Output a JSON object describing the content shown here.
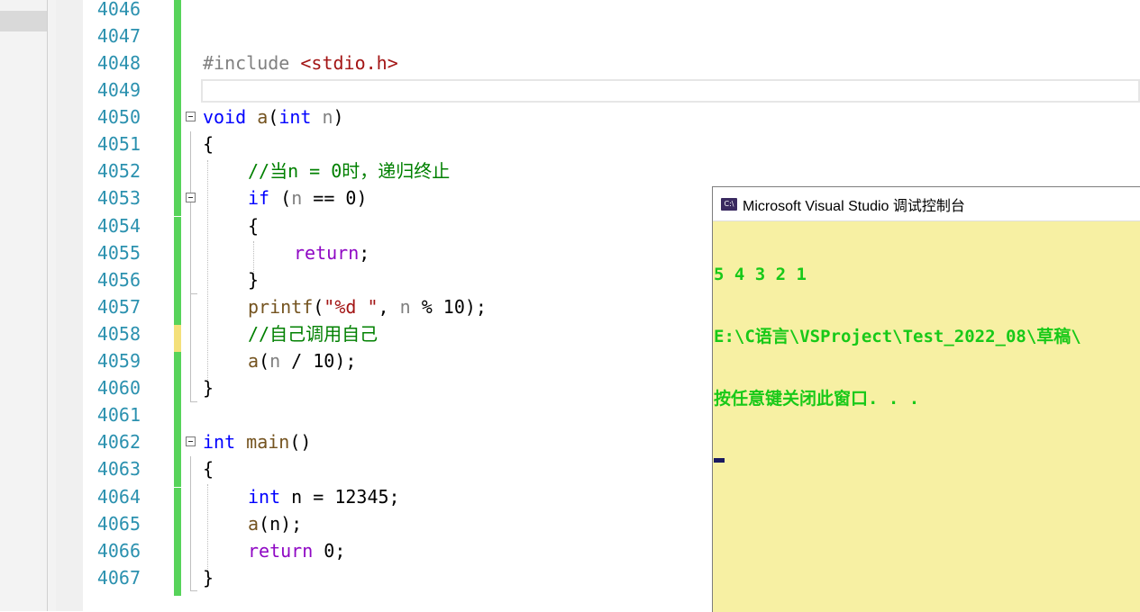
{
  "editor": {
    "lines": [
      {
        "num": "4046"
      },
      {
        "num": "4047"
      },
      {
        "num": "4048",
        "t1": "#include ",
        "t2": "<stdio.h>"
      },
      {
        "num": "4049"
      },
      {
        "num": "4050",
        "t1": "void",
        "t2": " a",
        "t3": "(",
        "t4": "int",
        "t5": " n",
        "t6": ")"
      },
      {
        "num": "4051",
        "t1": "{"
      },
      {
        "num": "4052",
        "t1": "//当n = 0时，递归终止"
      },
      {
        "num": "4053",
        "t1": "if",
        "t2": " (",
        "t3": "n",
        "t4": " == 0)"
      },
      {
        "num": "4054",
        "t1": "{"
      },
      {
        "num": "4055",
        "t1": "return",
        "t2": ";"
      },
      {
        "num": "4056",
        "t1": "}"
      },
      {
        "num": "4057",
        "t1": "printf",
        "t2": "(",
        "t3": "\"%d \"",
        "t4": ", ",
        "t5": "n",
        "t6": " % 10);"
      },
      {
        "num": "4058",
        "t1": "//自己调用自己"
      },
      {
        "num": "4059",
        "t1": "a",
        "t2": "(",
        "t3": "n",
        "t4": " / 10);"
      },
      {
        "num": "4060",
        "t1": "}"
      },
      {
        "num": "4061"
      },
      {
        "num": "4062",
        "t1": "int",
        "t2": " main",
        "t3": "()"
      },
      {
        "num": "4063",
        "t1": "{"
      },
      {
        "num": "4064",
        "t1": "int",
        "t2": " n = 12345;"
      },
      {
        "num": "4065",
        "t1": "a",
        "t2": "(n);"
      },
      {
        "num": "4066",
        "t1": "return",
        "t2": " 0;"
      },
      {
        "num": "4067",
        "t1": "}"
      }
    ]
  },
  "console": {
    "title": "Microsoft Visual Studio 调试控制台",
    "icon_text": "C:\\",
    "output": [
      "5 4 3 2 1",
      "E:\\C语言\\VSProject\\Test_2022_08\\草稿\\",
      "按任意键关闭此窗口. . ."
    ]
  },
  "colors": {
    "line_number": "#2b91af",
    "keyword": "#0000ff",
    "function": "#74531f",
    "string": "#a31515",
    "comment": "#008000",
    "change_bar": "#57d35a",
    "console_bg": "#f7f0a3",
    "console_text": "#18c918"
  }
}
